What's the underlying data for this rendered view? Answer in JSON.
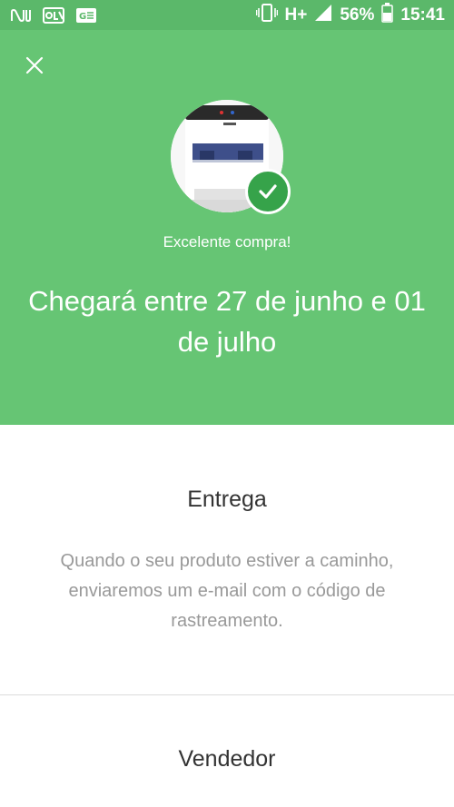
{
  "status_bar": {
    "apps": [
      "nubank-icon",
      "olx-icon",
      "news-icon"
    ],
    "battery": "56%",
    "network": "H+",
    "time": "15:41"
  },
  "hero": {
    "subtitle": "Excelente compra!",
    "title": "Chegará entre 27 de junho e 01 de julho",
    "background_color": "#66c574",
    "check_color": "#36a34a"
  },
  "delivery": {
    "title": "Entrega",
    "text": "Quando o seu produto estiver a caminho, enviaremos um e-mail com o código de rastreamento."
  },
  "seller": {
    "title": "Vendedor"
  }
}
